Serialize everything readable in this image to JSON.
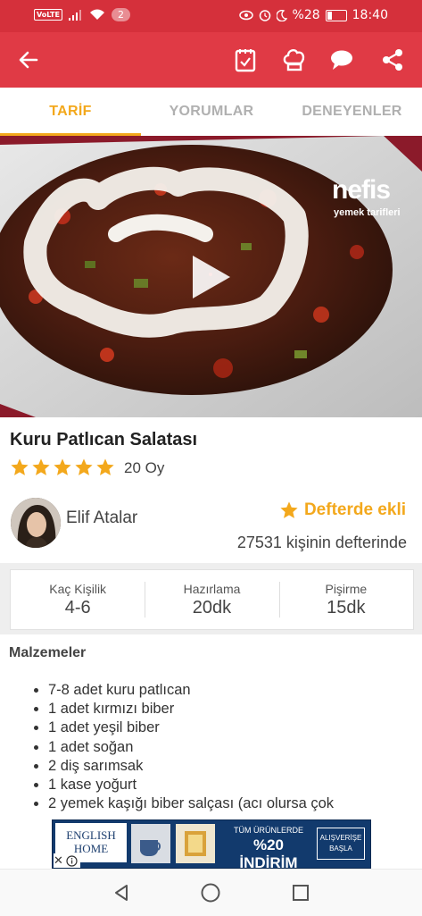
{
  "status_bar": {
    "volte": "VoLTE",
    "notification_count": "2",
    "battery": "%28",
    "time": "18:40"
  },
  "tabs": [
    {
      "label": "TARİF",
      "active": true
    },
    {
      "label": "YORUMLAR",
      "active": false
    },
    {
      "label": "DENEYENLER",
      "active": false
    }
  ],
  "hero": {
    "watermark": "nefis",
    "watermark_sub": "yemek tarifleri"
  },
  "recipe": {
    "title": "Kuru Patlıcan Salatası",
    "rating_stars": 5,
    "votes": "20 Oy",
    "author": "Elif Atalar",
    "defter_label": "Defterde ekli",
    "defter_count": "27531 kişinin defterinde"
  },
  "info": {
    "servings_label": "Kaç Kişilik",
    "servings_value": "4-6",
    "prep_label": "Hazırlama",
    "prep_value": "20dk",
    "cook_label": "Pişirme",
    "cook_value": "15dk"
  },
  "ingredients": {
    "title": "Malzemeler",
    "items": [
      "7-8 adet kuru patlıcan",
      "1 adet kırmızı biber",
      "1 adet yeşil biber",
      "1 adet soğan",
      "2 diş sarımsak",
      "1 kase yoğurt",
      "2 yemek kaşığı biber salçası (acı olursa çok"
    ]
  },
  "ad": {
    "brand_line1": "ENGLISH",
    "brand_line2": "HOME",
    "text_top": "TÜM ÜRÜNLERDE",
    "text_main": "%20 İNDİRİM",
    "cta": "ALIŞVERİŞE BAŞLA"
  },
  "colors": {
    "brand_red": "#e03a45",
    "status_red": "#d5303b",
    "accent_orange": "#f3a81c"
  }
}
